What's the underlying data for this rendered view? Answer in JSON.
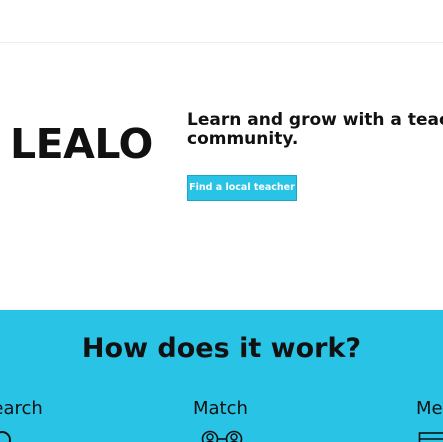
{
  "hero": {
    "brand": "LEALO",
    "tagline": "Learn and grow with a teacher community.",
    "cta_label": "Find a local teacher"
  },
  "how_it_works": {
    "title": "How does it work?",
    "steps": [
      {
        "label": "Search",
        "icon": "search-icon"
      },
      {
        "label": "Match",
        "icon": "people-match-icon"
      },
      {
        "label": "Meet",
        "icon": "calendar-icon"
      }
    ]
  },
  "colors": {
    "accent": "#29c3e6",
    "text": "#111111",
    "background": "#ffffff"
  }
}
